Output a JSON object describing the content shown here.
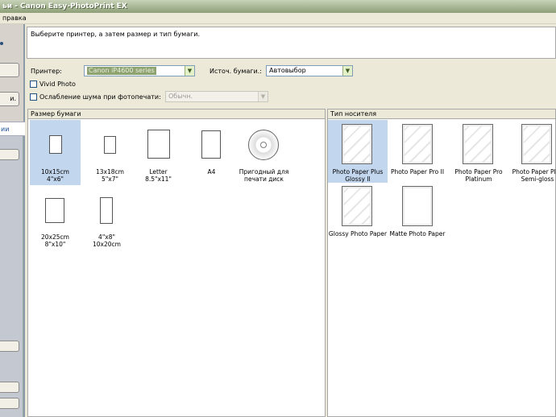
{
  "window": {
    "title": "ьи - Canon Easy-PhotoPrint EX"
  },
  "menu": {
    "help": "правка"
  },
  "sidebar": {
    "button_2": "и.",
    "tab_label": "ии"
  },
  "instruction": "Выберите принтер, а затем размер и тип бумаги.",
  "settings": {
    "printer_label": "Принтер:",
    "printer_value": "Canon iP4600 series",
    "source_label": "Источ. бумаги.:",
    "source_value": "Автовыбор",
    "vivid_label": "Vivid Photo",
    "noise_label": "Ослабление шума при фотопечати:",
    "noise_value": "Обычн."
  },
  "paper_size": {
    "header": "Размер бумаги",
    "items": [
      {
        "line1": "10x15cm",
        "line2": "4\"x6\""
      },
      {
        "line1": "13x18cm",
        "line2": "5\"x7\""
      },
      {
        "line1": "Letter",
        "line2": "8.5\"x11\""
      },
      {
        "line1": "A4",
        "line2": ""
      },
      {
        "line1": "Пригодный для",
        "line2": "печати диск"
      },
      {
        "line1": "20x25cm",
        "line2": "8\"x10\""
      },
      {
        "line1": "4\"x8\"",
        "line2": "10x20cm"
      }
    ]
  },
  "media_type": {
    "header": "Тип носителя",
    "items": [
      {
        "line1": "Photo Paper Plus",
        "line2": "Glossy II"
      },
      {
        "line1": "Photo Paper Pro II",
        "line2": ""
      },
      {
        "line1": "Photo Paper Pro",
        "line2": "Platinum"
      },
      {
        "line1": "Photo Paper Plus",
        "line2": "Semi-gloss"
      },
      {
        "line1": "Glossy Photo Paper",
        "line2": ""
      },
      {
        "line1": "Matte Photo Paper",
        "line2": ""
      }
    ]
  }
}
